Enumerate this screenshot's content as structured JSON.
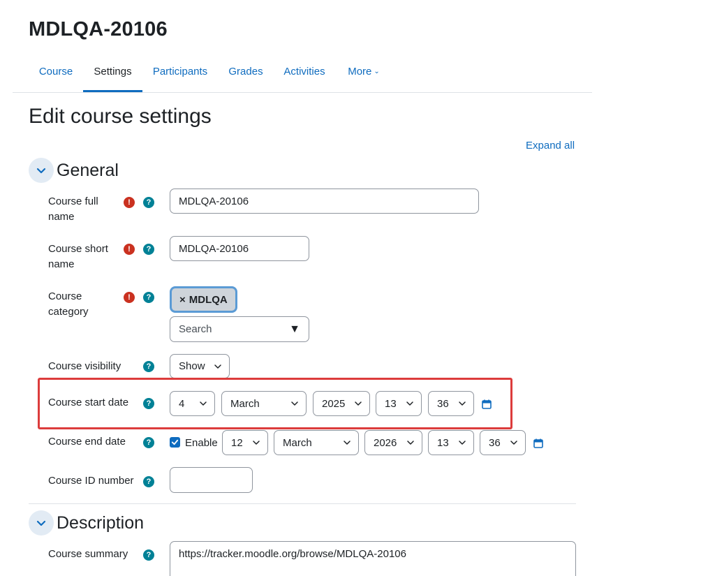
{
  "course": {
    "title": "MDLQA-20106"
  },
  "nav": {
    "tabs": [
      "Course",
      "Settings",
      "Participants",
      "Grades",
      "Activities"
    ],
    "more_label": "More"
  },
  "page": {
    "heading": "Edit course settings",
    "expand_all": "Expand all"
  },
  "sections": {
    "general": "General",
    "description": "Description"
  },
  "fields": {
    "fullname": {
      "label_line1": "Course full",
      "label_line2": "name",
      "value": "MDLQA-20106"
    },
    "shortname": {
      "label_line1": "Course short",
      "label_line2": "name",
      "value": "MDLQA-20106"
    },
    "category": {
      "label_line1": "Course",
      "label_line2": "category",
      "chip": "MDLQA",
      "chip_remove": "×",
      "search_placeholder": "Search",
      "dropdown_glyph": "▼"
    },
    "visibility": {
      "label": "Course visibility",
      "value": "Show"
    },
    "startdate": {
      "label": "Course start date",
      "day": "4",
      "month": "March",
      "year": "2025",
      "hour": "13",
      "minute": "36"
    },
    "enddate": {
      "label": "Course end date",
      "enable_label": "Enable",
      "enabled": true,
      "day": "12",
      "month": "March",
      "year": "2026",
      "hour": "13",
      "minute": "36"
    },
    "idnumber": {
      "label": "Course ID number",
      "value": ""
    },
    "summary": {
      "label": "Course summary",
      "value": "https://tracker.moodle.org/browse/MDLQA-20106"
    }
  },
  "icons": {
    "required": "!",
    "help": "?",
    "required_color": "#ca3120",
    "help_color": "#008196",
    "accent_color": "#0f6cbf",
    "highlight_color": "#dc3c3c"
  }
}
